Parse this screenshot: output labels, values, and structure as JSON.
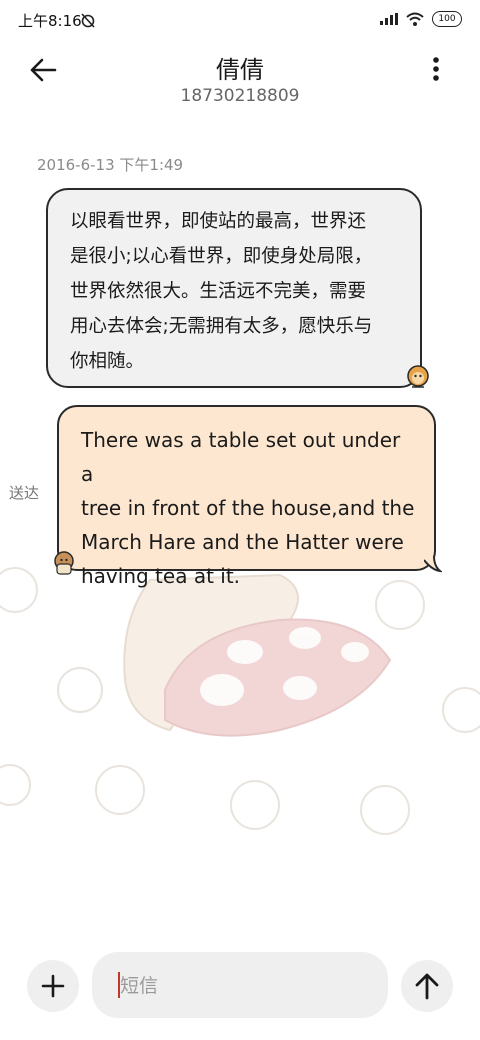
{
  "status_bar": {
    "time": "上午8:16",
    "battery": "100",
    "icons": [
      "alarm-off-icon",
      "signal-icon",
      "wifi-icon",
      "battery-icon"
    ]
  },
  "header": {
    "contact_name": "倩倩",
    "contact_number": "18730218809",
    "icons": [
      "back-arrow-icon",
      "more-vertical-icon"
    ]
  },
  "conversation": {
    "timestamp": "2016-6-13 下午1:49",
    "messages": [
      {
        "direction": "incoming",
        "lines": [
          "以眼看世界，即使站的最高，世界还",
          "是很小;以心看世界，即使身处局限，",
          "世界依然很大。生活远不完美，需要",
          "用心去体会;无需拥有太多，愿快乐与",
          "你相随。"
        ]
      },
      {
        "direction": "outgoing",
        "lines": [
          "There was a table set out under a",
          "tree in front of the house,and the",
          "March Hare and the Hatter were",
          "having tea at it."
        ],
        "status": "送达"
      }
    ]
  },
  "composer": {
    "placeholder": "短信",
    "value": "",
    "icons": [
      "plus-icon",
      "send-arrow-icon"
    ]
  },
  "colors": {
    "incoming_bubble": "#f1f1f1",
    "outgoing_bubble": "#fde7d0",
    "bubble_border": "#2a2a2a",
    "caret": "#c0392b"
  }
}
